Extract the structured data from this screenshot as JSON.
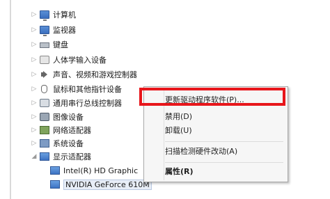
{
  "tree": {
    "items": [
      {
        "label": "计算机",
        "icon": "computer-icon"
      },
      {
        "label": "监视器",
        "icon": "monitor-icon"
      },
      {
        "label": "键盘",
        "icon": "keyboard-icon"
      },
      {
        "label": "人体学输入设备",
        "icon": "hid-icon"
      },
      {
        "label": "声音、视频和游戏控制器",
        "icon": "speaker-icon"
      },
      {
        "label": "鼠标和其他指针设备",
        "icon": "mouse-icon"
      },
      {
        "label": "通用串行总线控制器",
        "icon": "usb-icon"
      },
      {
        "label": "图像设备",
        "icon": "imaging-icon"
      },
      {
        "label": "网络适配器",
        "icon": "network-icon"
      },
      {
        "label": "系统设备",
        "icon": "system-icon"
      },
      {
        "label": "显示适配器",
        "icon": "display-adapter-icon"
      }
    ],
    "children": [
      {
        "label": "Intel(R) HD Graphic",
        "icon": "gpu-icon"
      },
      {
        "label": "NVIDIA GeForce 610M",
        "icon": "gpu-icon"
      }
    ]
  },
  "context_menu": {
    "items": [
      {
        "label": "更新驱动程序软件(P)..."
      },
      {
        "label": "禁用(D)"
      },
      {
        "label": "卸载(U)"
      },
      {
        "label": "扫描检测硬件改动(A)"
      },
      {
        "label": "属性(R)"
      }
    ]
  },
  "colors": {
    "highlight": "#e8161b",
    "menu_bg": "#f6f6f6"
  }
}
